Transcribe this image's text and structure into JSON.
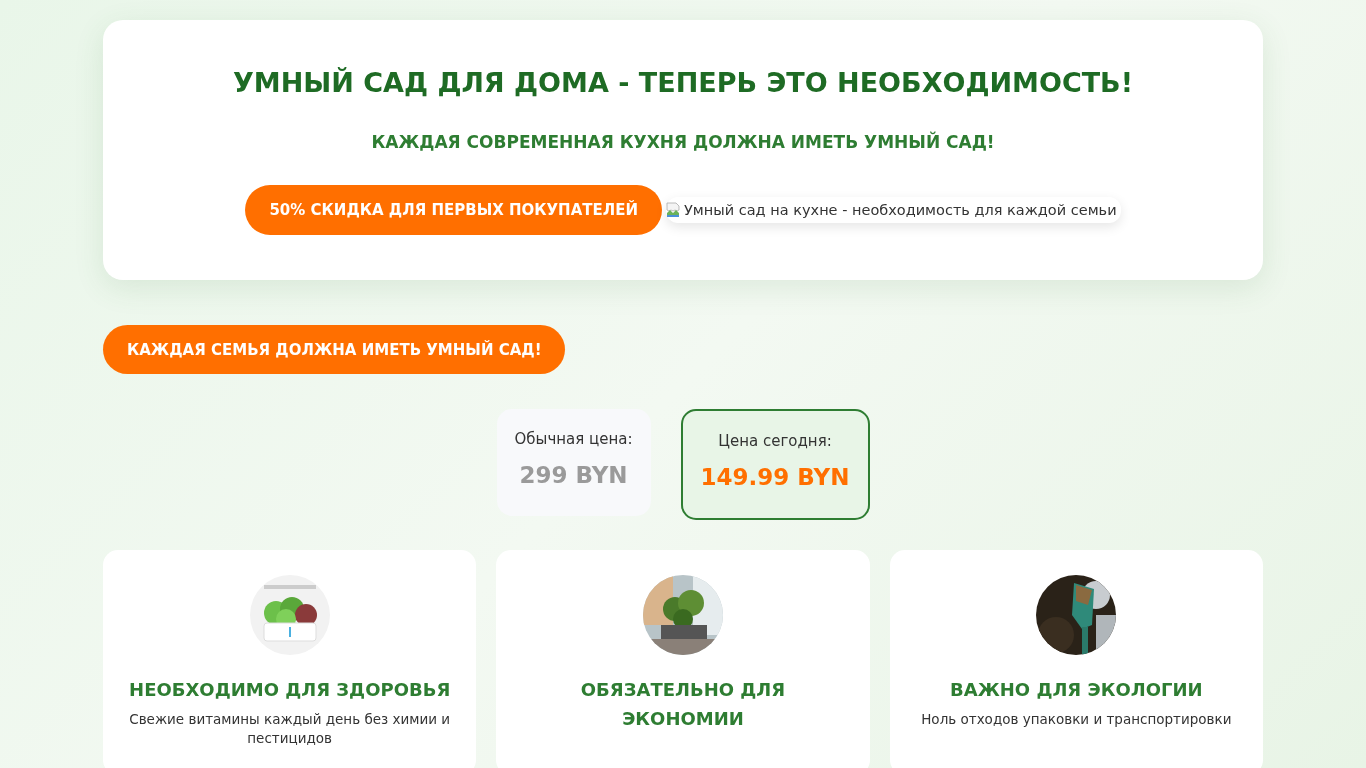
{
  "hero": {
    "title": "УМНЫЙ САД ДЛЯ ДОМА - ТЕПЕРЬ ЭТО НЕОБХОДИМОСТЬ!",
    "subtitle": "КАЖДАЯ СОВРЕМЕННАЯ КУХНЯ ДОЛЖНА ИМЕТЬ УМНЫЙ САД!",
    "discount_button": "50% СКИДКА ДЛЯ ПЕРВЫХ ПОКУПАТЕЛЕЙ",
    "image_alt": "Умный сад на кухне - необходимость для каждой семьи"
  },
  "cta_button": "КАЖДАЯ СЕМЬЯ ДОЛЖНА ИМЕТЬ УМНЫЙ САД!",
  "prices": [
    {
      "kind": "regular",
      "label": "Обычная цена:",
      "value": "299 BYN"
    },
    {
      "kind": "today",
      "label": "Цена сегодня:",
      "value": "149.99 BYN"
    }
  ],
  "features": [
    {
      "title": "НЕОБХОДИМО ДЛЯ ЗДОРОВЬЯ",
      "text": "Свежие витамины каждый день без химии и пестицидов"
    },
    {
      "title": "ОБЯЗАТЕЛЬНО ДЛЯ ЭКОНОМИИ"
    },
    {
      "title": "ВАЖНО ДЛЯ ЭКОЛОГИИ",
      "text": "Ноль отходов упаковки и транспортировки"
    }
  ]
}
